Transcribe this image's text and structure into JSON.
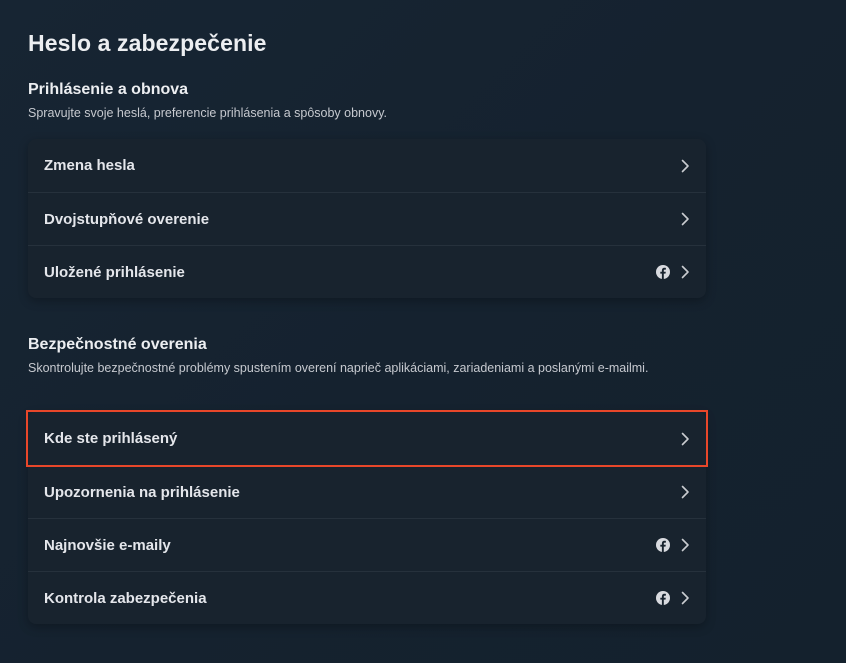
{
  "page": {
    "title": "Heslo a zabezpečenie"
  },
  "login_section": {
    "heading": "Prihlásenie a obnova",
    "description": "Spravujte svoje heslá, preferencie prihlásenia a spôsoby obnovy.",
    "items": [
      {
        "label": "Zmena hesla",
        "has_facebook_icon": false
      },
      {
        "label": "Dvojstupňové overenie",
        "has_facebook_icon": false
      },
      {
        "label": "Uložené prihlásenie",
        "has_facebook_icon": true
      }
    ]
  },
  "security_section": {
    "heading": "Bezpečnostné overenia",
    "description": "Skontrolujte bezpečnostné problémy spustením overení naprieč aplikáciami, zariadeniami a poslanými e-mailmi.",
    "items": [
      {
        "label": "Kde ste prihlásený",
        "has_facebook_icon": false,
        "highlighted": true
      },
      {
        "label": "Upozornenia na prihlásenie",
        "has_facebook_icon": false
      },
      {
        "label": "Najnovšie e-maily",
        "has_facebook_icon": true
      },
      {
        "label": "Kontrola zabezpečenia",
        "has_facebook_icon": true
      }
    ]
  },
  "icons": {
    "facebook": "facebook-icon",
    "chevron": "chevron-right-icon"
  },
  "colors": {
    "background": "#16232f",
    "card": "#18232e",
    "highlight": "#e8472a",
    "text": "#e4e6eb"
  }
}
